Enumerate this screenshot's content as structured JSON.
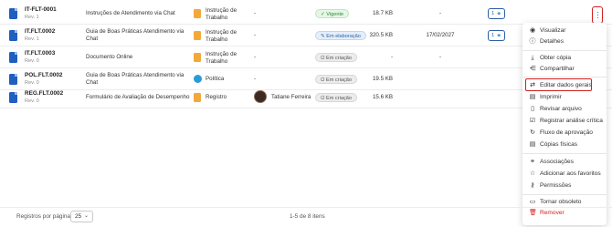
{
  "rows": [
    {
      "code": "IT-FLT-0001",
      "rev": "Rev. 1",
      "title": "Instruções de Atendimento via Chat",
      "type": "Instrução de Trabalho",
      "type_color": "#f2a93b",
      "author": "-",
      "status": "Vigente",
      "status_tone": "green",
      "size": "18.7 KB",
      "date": "-",
      "links": "1"
    },
    {
      "code": "IT.FLT.0002",
      "rev": "Rev. 1",
      "title": "Guia de Boas Práticas Atendimento via Chat",
      "type": "Instrução de Trabalho",
      "type_color": "#f2a93b",
      "author": "-",
      "status": "Em elaboração",
      "status_tone": "blue",
      "size": "320.5 KB",
      "date": "17/02/2027",
      "links": "1"
    },
    {
      "code": "IT.FLT.0003",
      "rev": "Rev. 0",
      "title": "Documento Online",
      "type": "Instrução de Trabalho",
      "type_color": "#f2a93b",
      "author": "-",
      "status": "Em criação",
      "status_tone": "grey",
      "size": "-",
      "date": "-",
      "links": ""
    },
    {
      "code": "POL.FLT.0002",
      "rev": "Rev. 0",
      "title": "Guia de Boas Práticas Atendimento via Chat",
      "type": "Política",
      "type_color": "#2a9bd8",
      "author": "-",
      "status": "Em criação",
      "status_tone": "grey",
      "size": "19.5 KB",
      "date": "",
      "links": ""
    },
    {
      "code": "REG.FLT.0002",
      "rev": "Rev. 0",
      "title": "Formulário de Avaliação de Desempenho",
      "type": "Registro",
      "type_color": "#f2a93b",
      "author": "Tatiane Ferreira",
      "status": "Em criação",
      "status_tone": "grey",
      "size": "15.6 KB",
      "date": "",
      "links": ""
    }
  ],
  "menu": {
    "items": [
      {
        "icon": "eye-icon",
        "glyph": "◉",
        "label": "Visualizar"
      },
      {
        "icon": "info-icon",
        "glyph": "ⓘ",
        "label": "Detalhes"
      },
      {
        "icon": "download-icon",
        "glyph": "⤓",
        "label": "Obter cópia"
      },
      {
        "icon": "share-icon",
        "glyph": "⋲",
        "label": "Compartilhar"
      },
      {
        "icon": "sliders-icon",
        "glyph": "⇄",
        "label": "Editar dados gerais"
      },
      {
        "icon": "print-icon",
        "glyph": "▤",
        "label": "Imprimir"
      },
      {
        "icon": "review-file-icon",
        "glyph": "▯",
        "label": "Revisar arquivo"
      },
      {
        "icon": "checklist-icon",
        "glyph": "☑",
        "label": "Registrar análise crítica"
      },
      {
        "icon": "flow-icon",
        "glyph": "↻",
        "label": "Fluxo de aprovação"
      },
      {
        "icon": "print-copies-icon",
        "glyph": "▤",
        "label": "Cópias físicas"
      },
      {
        "icon": "link-icon",
        "glyph": "⚭",
        "label": "Associações"
      },
      {
        "icon": "star-icon",
        "glyph": "☆",
        "label": "Adicionar aos favoritos"
      },
      {
        "icon": "key-icon",
        "glyph": "⚷",
        "label": "Permissões"
      },
      {
        "icon": "archive-icon",
        "glyph": "▭",
        "label": "Tornar obsoleto"
      },
      {
        "icon": "trash-icon",
        "glyph": "🗑",
        "label": "Remover"
      }
    ]
  },
  "footer": {
    "rows_per_page_label": "Registros por página",
    "rows_per_page_value": "25",
    "pager_info": "1-5 de 8 itens"
  },
  "colors": {
    "accent": "#1f5fbf",
    "highlight": "#d22020"
  }
}
